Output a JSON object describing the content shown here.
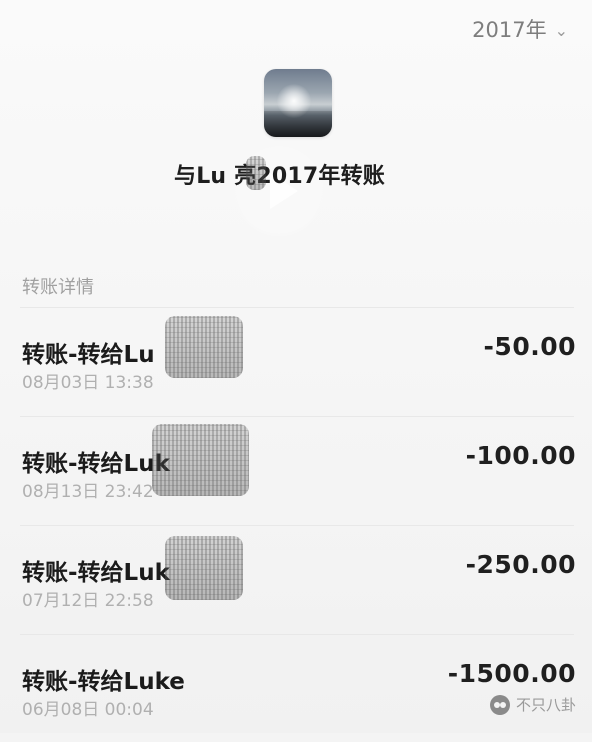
{
  "header": {
    "year_label": "2017年",
    "dropdown_icon": "chevron-down-icon"
  },
  "profile": {
    "avatar_icon": "profile-avatar",
    "title": "与Lu 亮2017年转账"
  },
  "overlay": {
    "play_icon": "play-icon"
  },
  "section": {
    "label": "转账详情"
  },
  "transactions": [
    {
      "label": "转账-转给Lu",
      "time": "08月03日 13:38",
      "amount": "-50.00"
    },
    {
      "label": "转账-转给Luk",
      "time": "08月13日 23:42",
      "amount": "-100.00"
    },
    {
      "label": "转账-转给Luk",
      "time": "07月12日 22:58",
      "amount": "-250.00"
    },
    {
      "label": "转账-转给Luke",
      "time": "06月08日 00:04",
      "amount": "-1500.00"
    }
  ],
  "watermark": {
    "text": "不只八卦",
    "icon": "wechat-icon"
  }
}
